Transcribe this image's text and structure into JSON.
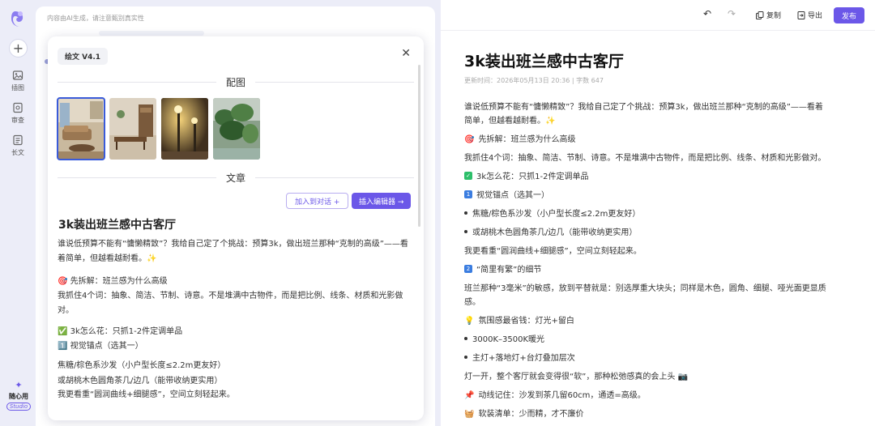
{
  "sidebar": {
    "items": [
      {
        "label": "插图",
        "icon": "image-icon"
      },
      {
        "label": "审查",
        "icon": "review-icon"
      },
      {
        "label": "长文",
        "icon": "document-icon"
      }
    ],
    "studio_name": "随心用",
    "studio_tag": "Studio"
  },
  "chat": {
    "disclaimer": "内容由AI生成，请注意甄别真实性"
  },
  "modal": {
    "version": "绘文 V4.1",
    "images_section": "配图",
    "article_section": "文章",
    "add_to_chat": "加入到对话 +",
    "insert_editor": "插入编辑器 →",
    "title": "3k装出班兰感中古客厅",
    "paragraphs": [
      "谁说低预算不能有“慵懒精致”？我给自己定了个挑战：预算3k，做出班兰那种“克制的高级”——看着简单，但越看越耐看。✨",
      "🎯 先拆解：班兰感为什么高级",
      "我抓住4个词：抽象、简洁、节制、诗意。不是堆满中古物件，而是把比例、线条、材质和光影做对。",
      "✅ 3k怎么花：只抓1-2件定调单品",
      "1️⃣ 视觉锚点（选其一）",
      "焦糖/棕色系沙发（小户型长度≤2.2m更友好）",
      "或胡桃木色圆角茶几/边几（能带收纳更实用）",
      "我更看重“圆润曲线+细腿感”，空间立刻轻起来。"
    ]
  },
  "editor": {
    "toolbar": {
      "undo": "↶",
      "redo": "↷",
      "copy": "复制",
      "export": "导出",
      "publish": "发布"
    },
    "title": "3k装出班兰感中古客厅",
    "meta": "更新时间：2026年05月13日 20:36  |  字数 647",
    "lines": [
      "谁说低预算不能有“慵懒精致”？我给自己定了个挑战：预算3k，做出班兰那种“克制的高级”——看着",
      "简单，但越看越耐看。✨",
      "先拆解：班兰感为什么高级",
      "我抓住4个词：抽象、简洁、节制、诗意。不是堆满中古物件，而是把比例、线条、材质和光影做对。",
      "3k怎么花：只抓1-2件定调单品",
      "视觉锚点（选其一）",
      "焦糖/棕色系沙发（小户型长度≤2.2m更友好）",
      "或胡桃木色圆角茶几/边几（能带收纳更实用）",
      "我更看重“圆润曲线+细腿感”，空间立刻轻起来。",
      "“简里有繁”的细节",
      "班兰那种“3毫米”的敏感，放到平替就是：别选厚重大块头；同样是木色，圆角、细腿、哑光面更显质",
      "感。",
      "氛围感最省钱：灯光+留白",
      "3000K–3500K暖光",
      "主灯+落地灯+台灯叠加层次",
      "灯一开，整个客厅就会变得很“软”，那种松弛感真的会上头",
      "动线记住：沙发到茶几留60cm，通透=高级。",
      "软装清单：少而精，才不廉价"
    ],
    "markers": {
      "target": "🎯",
      "check": "✓",
      "one": "1",
      "two": "2",
      "bulb": "💡",
      "pin": "📌",
      "basket": "🧺",
      "camera": "📷"
    }
  },
  "colors": {
    "accent": "#6b57e8",
    "background": "#ecedf8",
    "number_badge": "#3b7de0",
    "check_badge": "#2dbf6a"
  }
}
